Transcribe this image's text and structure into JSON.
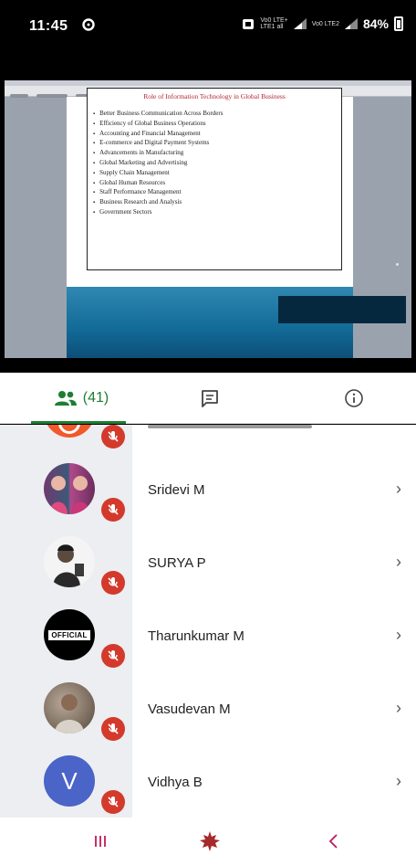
{
  "status_bar": {
    "time": "11:45",
    "battery": "84%",
    "signal_text_1": "Vo0 LTE+",
    "signal_text_2": "LTE1 all",
    "signal_text_3": "Vo0 LTE2"
  },
  "slide": {
    "title": "Role of Information Technology in Global Business",
    "items": [
      "Better Business Communication Across Borders",
      "Efficiency of Global Business Operations",
      "Accounting and Financial Management",
      "E-commerce and Digital Payment Systems",
      "Advancements in Manufacturing",
      "Global Marketing and Advertising",
      "Supply Chain Management",
      "Global Human Resources",
      "Staff Performance Management",
      "Business Research and Analysis",
      "Government Sectors"
    ]
  },
  "tabs": {
    "people_count": "(41)",
    "people_icon": "people-icon",
    "chat_icon": "chat-icon",
    "info_icon": "info-icon",
    "accent_color": "#1e7e34"
  },
  "participants": [
    {
      "name": "Sridevi M",
      "avatar": "photo"
    },
    {
      "name": "SURYA P",
      "avatar": "photo"
    },
    {
      "name": "Tharunkumar M",
      "avatar": "official-logo",
      "avatar_text": "OFFICIAL"
    },
    {
      "name": "Vasudevan M",
      "avatar": "photo"
    },
    {
      "name": "Vidhya B",
      "avatar": "initial",
      "avatar_text": "V",
      "avatar_color": "#4a64c8"
    }
  ],
  "colors": {
    "mute_badge": "#d33a2c",
    "partial_avatar": "#f1582a"
  },
  "nav": {
    "recents_icon": "recents-icon",
    "home_icon": "home-icon",
    "back_icon": "back-icon"
  }
}
